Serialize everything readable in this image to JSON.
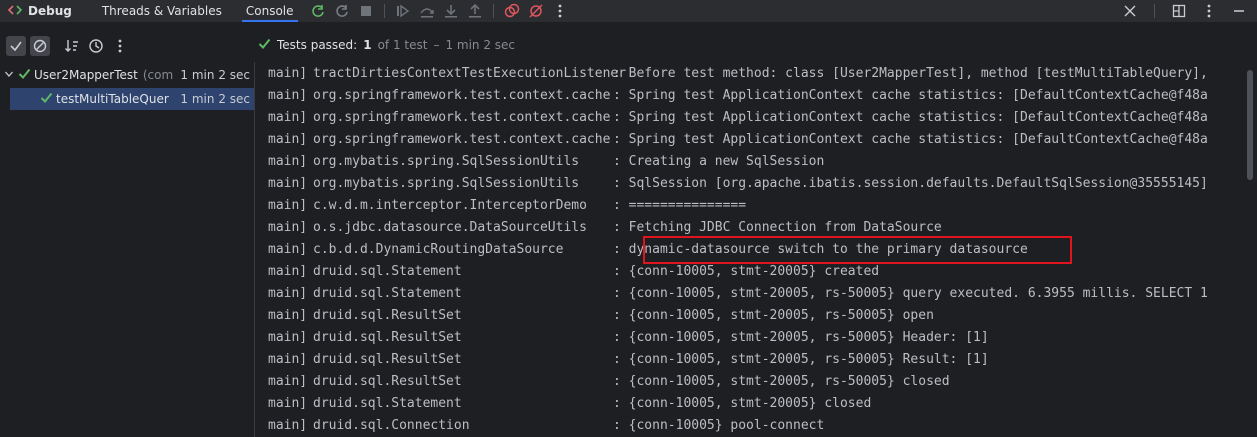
{
  "toolbar": {
    "debug_label": "Debug",
    "tabs": [
      {
        "label": "Threads & Variables"
      },
      {
        "label": "Console"
      }
    ],
    "icons": [
      "rerun-icon",
      "rerun-failed-icon",
      "stop-icon",
      "resume-program-icon",
      "step-over-icon",
      "step-into-icon",
      "step-out-icon",
      "view-breakpoints-icon",
      "mute-breakpoints-icon",
      "more-icon"
    ],
    "accent_color": "#3574f0"
  },
  "test_status": {
    "passed_label": "Tests passed:",
    "passed_count": "1",
    "of_total": "of 1 test",
    "separator": "–",
    "duration": "1 min 2 sec",
    "pass_color": "#5fb865"
  },
  "test_tree": {
    "root": {
      "name": "User2MapperTest",
      "package": "(com",
      "time": "1 min 2 sec"
    },
    "child": {
      "name": "testMultiTableQuer",
      "time": "1 min 2 sec"
    }
  },
  "console": {
    "lines": [
      {
        "thread": "main]",
        "logger": "tractDirtiesContextTestExecutionListener",
        "msg": ": Before test method: class [User2MapperTest], method [testMultiTableQuery],"
      },
      {
        "thread": "main]",
        "logger": "org.springframework.test.context.cache",
        "msg": ": Spring test ApplicationContext cache statistics: [DefaultContextCache@f48a"
      },
      {
        "thread": "main]",
        "logger": "org.springframework.test.context.cache",
        "msg": ": Spring test ApplicationContext cache statistics: [DefaultContextCache@f48a"
      },
      {
        "thread": "main]",
        "logger": "org.springframework.test.context.cache",
        "msg": ": Spring test ApplicationContext cache statistics: [DefaultContextCache@f48a"
      },
      {
        "thread": "main]",
        "logger": "org.mybatis.spring.SqlSessionUtils",
        "msg": ": Creating a new SqlSession"
      },
      {
        "thread": "main]",
        "logger": "org.mybatis.spring.SqlSessionUtils",
        "msg": ": SqlSession [org.apache.ibatis.session.defaults.DefaultSqlSession@35555145]"
      },
      {
        "thread": "main]",
        "logger": "c.w.d.m.interceptor.InterceptorDemo",
        "msg": ": ==============="
      },
      {
        "thread": "main]",
        "logger": "o.s.jdbc.datasource.DataSourceUtils",
        "msg": ": Fetching JDBC Connection from DataSource"
      },
      {
        "thread": "main]",
        "logger": "c.b.d.d.DynamicRoutingDataSource",
        "msg": ": dynamic-datasource switch to the primary datasource"
      },
      {
        "thread": "main]",
        "logger": "druid.sql.Statement",
        "msg": ": {conn-10005, stmt-20005} created"
      },
      {
        "thread": "main]",
        "logger": "druid.sql.Statement",
        "msg": ": {conn-10005, stmt-20005, rs-50005} query executed. 6.3955 millis. SELECT 1"
      },
      {
        "thread": "main]",
        "logger": "druid.sql.ResultSet",
        "msg": ": {conn-10005, stmt-20005, rs-50005} open"
      },
      {
        "thread": "main]",
        "logger": "druid.sql.ResultSet",
        "msg": ": {conn-10005, stmt-20005, rs-50005} Header: [1]"
      },
      {
        "thread": "main]",
        "logger": "druid.sql.ResultSet",
        "msg": ": {conn-10005, stmt-20005, rs-50005} Result: [1]"
      },
      {
        "thread": "main]",
        "logger": "druid.sql.ResultSet",
        "msg": ": {conn-10005, stmt-20005, rs-50005} closed"
      },
      {
        "thread": "main]",
        "logger": "druid.sql.Statement",
        "msg": ": {conn-10005, stmt-20005} closed"
      },
      {
        "thread": "main]",
        "logger": "druid.sql.Connection",
        "msg": ": {conn-10005} pool-connect"
      }
    ],
    "highlight_color": "#e0141c"
  }
}
